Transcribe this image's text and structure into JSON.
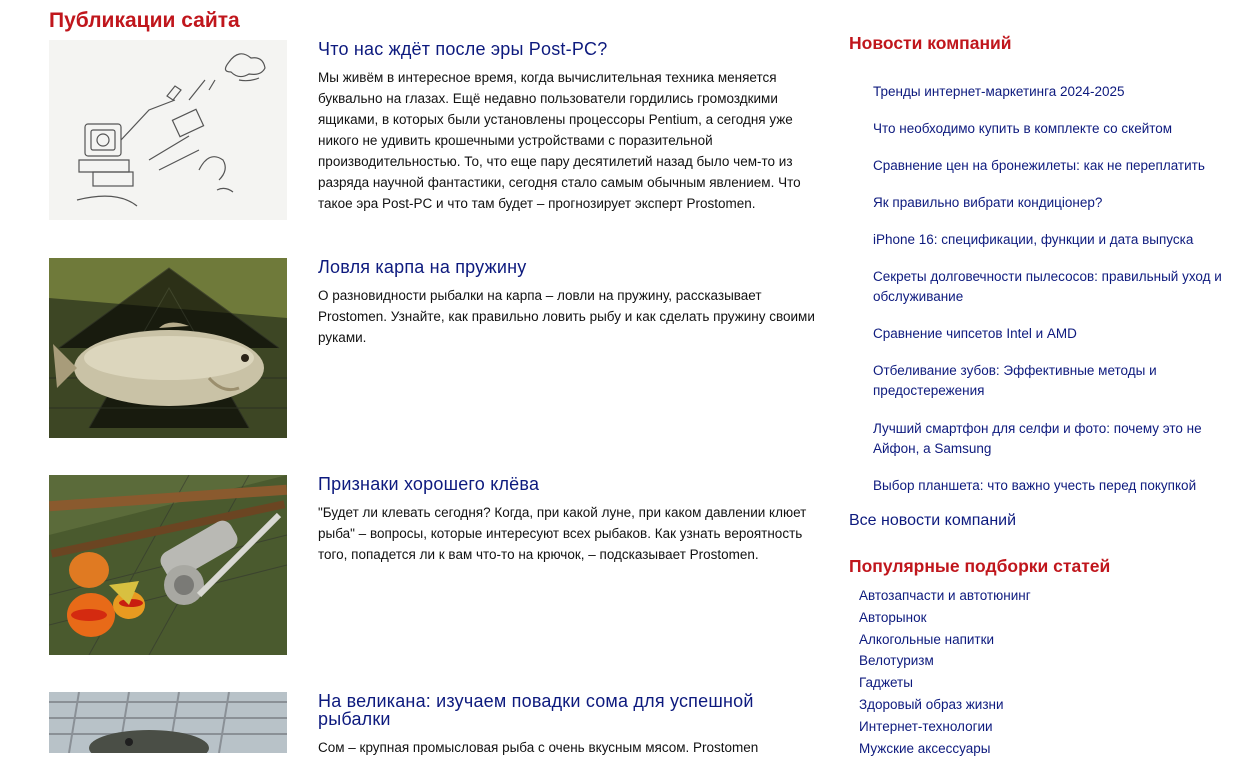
{
  "main": {
    "title": "Публикации сайта",
    "articles": [
      {
        "title": "Что нас ждёт после эры Post-PC?",
        "text": "Мы живём в интересное время, когда вычислительная техника меняется буквально на глазах. Ещё недавно пользователи гордились громоздкими ящиками, в которых были установлены процессоры Pentium, а сегодня уже никого не удивить крошечными устройствами с поразительной производительностью. То, что еще пару десятилетий назад было чем-то из разряда научной фантастики, сегодня стало самым обычным явлением. Что такое эра Post-PC и что там будет – прогнозирует эксперт Prostomen."
      },
      {
        "title": "Ловля карпа на пружину",
        "text": "О разновидности рыбалки на карпа – ловли на пружину, рассказывает Prostomen. Узнайте, как правильно ловить рыбу и как сделать пружину своими руками."
      },
      {
        "title": "Признаки хорошего клёва",
        "text": "\"Будет ли клевать сегодня? Когда, при какой луне, при каком давлении клюет рыба\" – вопросы, которые интересуют всех рыбаков. Как узнать вероятность того, попадется ли к вам что-то на крючок, – подсказывает Prostomen."
      },
      {
        "title": "На великана: изучаем повадки сома для успешной рыбалки",
        "text": "Сом – крупная промысловая рыба с очень вкусным мясом. Prostomen"
      }
    ]
  },
  "sidebar": {
    "news_title": "Новости компаний",
    "news": [
      "Тренды интернет-маркетинга 2024-2025",
      "Что необходимо купить в комплекте со скейтом",
      "Сравнение цен на бронежилеты: как не переплатить",
      "Як правильно вибрати кондиціонер?",
      "iPhone 16: спецификации, функции и дата выпуска",
      "Секреты долговечности пылесосов: правильный уход и обслуживание",
      "Сравнение чипсетов Intel и AMD",
      "Отбеливание зубов: Эффективные методы и предостережения",
      "Лучший смартфон для селфи и фото: почему это не Айфон, а Samsung",
      "Выбор планшета: что важно учесть перед покупкой"
    ],
    "all_news": "Все новости компаний",
    "popular_title": "Популярные подборки статей",
    "categories": [
      "Автозапчасти и автотюнинг",
      "Авторынок",
      "Алкогольные напитки",
      "Велотуризм",
      "Гаджеты",
      "Здоровый образ жизни",
      "Интернет-технологии",
      "Мужские аксессуары"
    ]
  },
  "colors": {
    "heading_red": "#c0161c",
    "link_blue": "#0d1a7e"
  }
}
